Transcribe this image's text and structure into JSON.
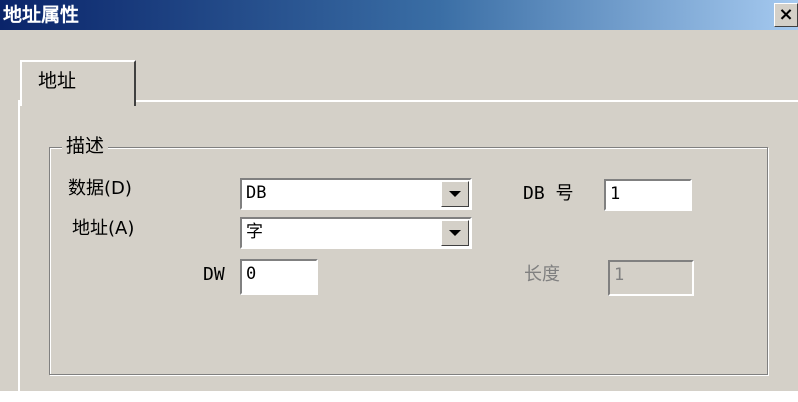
{
  "window": {
    "title": "地址属性",
    "close_glyph": "×"
  },
  "tabs": [
    {
      "label": "地址",
      "selected": true
    }
  ],
  "group": {
    "legend": "描述"
  },
  "data_field": {
    "label": "数据(D)",
    "value": "DB"
  },
  "address_field": {
    "label": "地址(A)",
    "value": "字"
  },
  "dw_field": {
    "label": "DW",
    "value": "0"
  },
  "db_number": {
    "label": "DB 号",
    "value": "1"
  },
  "length": {
    "label": "长度",
    "value": "1",
    "enabled": false
  }
}
